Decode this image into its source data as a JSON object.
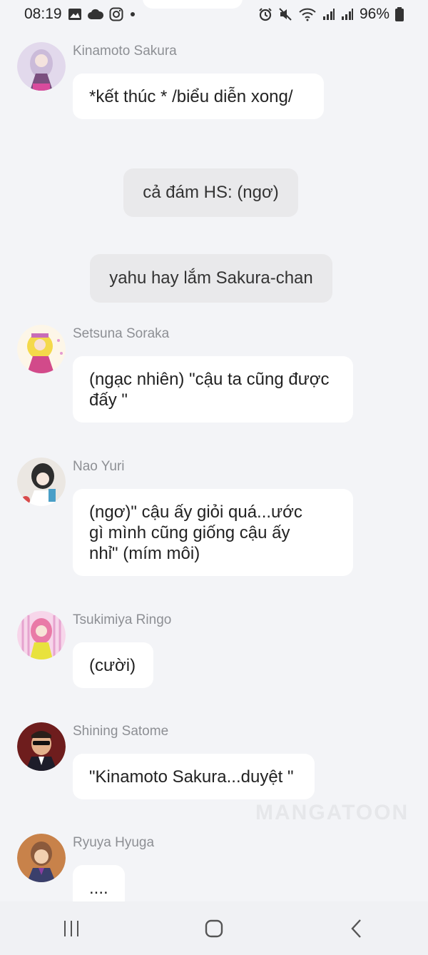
{
  "status_bar": {
    "time": "08:19",
    "left_icons": [
      "image-icon",
      "cloud-icon",
      "instagram-icon",
      "dot-icon"
    ],
    "right_icons": [
      "alarm-icon",
      "mute-icon",
      "wifi-icon",
      "signal-icon",
      "signal-icon"
    ],
    "battery": "96%"
  },
  "messages": [
    {
      "sender": "Kinamoto Sakura",
      "text": "*kết thúc * /biểu diễn xong/",
      "avatar_colors": [
        "#d7c7e6",
        "#7b4f7f"
      ]
    },
    {
      "sender": "Setsuna Soraka",
      "text": "(ngạc nhiên) \"cậu ta cũng được đấy \"",
      "avatar_colors": [
        "#f7e36a",
        "#d24a8a"
      ]
    },
    {
      "sender": "Nao Yuri",
      "text": "(ngơ)\" cậu ấy giỏi quá...ước gì mình cũng giống cậu ấy nhỉ\" (mím môi)",
      "avatar_colors": [
        "#e8e4df",
        "#2d2d2d"
      ]
    },
    {
      "sender": "Tsukimiya Ringo",
      "text": "(cười)",
      "avatar_colors": [
        "#f2b6d6",
        "#e8e23d"
      ]
    },
    {
      "sender": "Shining Satome",
      "text": "\"Kinamoto Sakura...duyệt \"",
      "avatar_colors": [
        "#7b1d1d",
        "#1d1d2a"
      ]
    },
    {
      "sender": "Ryuya Hyuga",
      "text": "....",
      "avatar_colors": [
        "#c8824a",
        "#5a3f2f"
      ]
    }
  ],
  "narrations": [
    {
      "text": "cả đám HS: (ngơ)"
    },
    {
      "text": "yahu hay lắm Sakura-chan"
    }
  ],
  "watermark": "MANGATOON",
  "nav_bar": {
    "buttons": [
      "recent-apps-icon",
      "home-icon",
      "back-icon"
    ]
  }
}
